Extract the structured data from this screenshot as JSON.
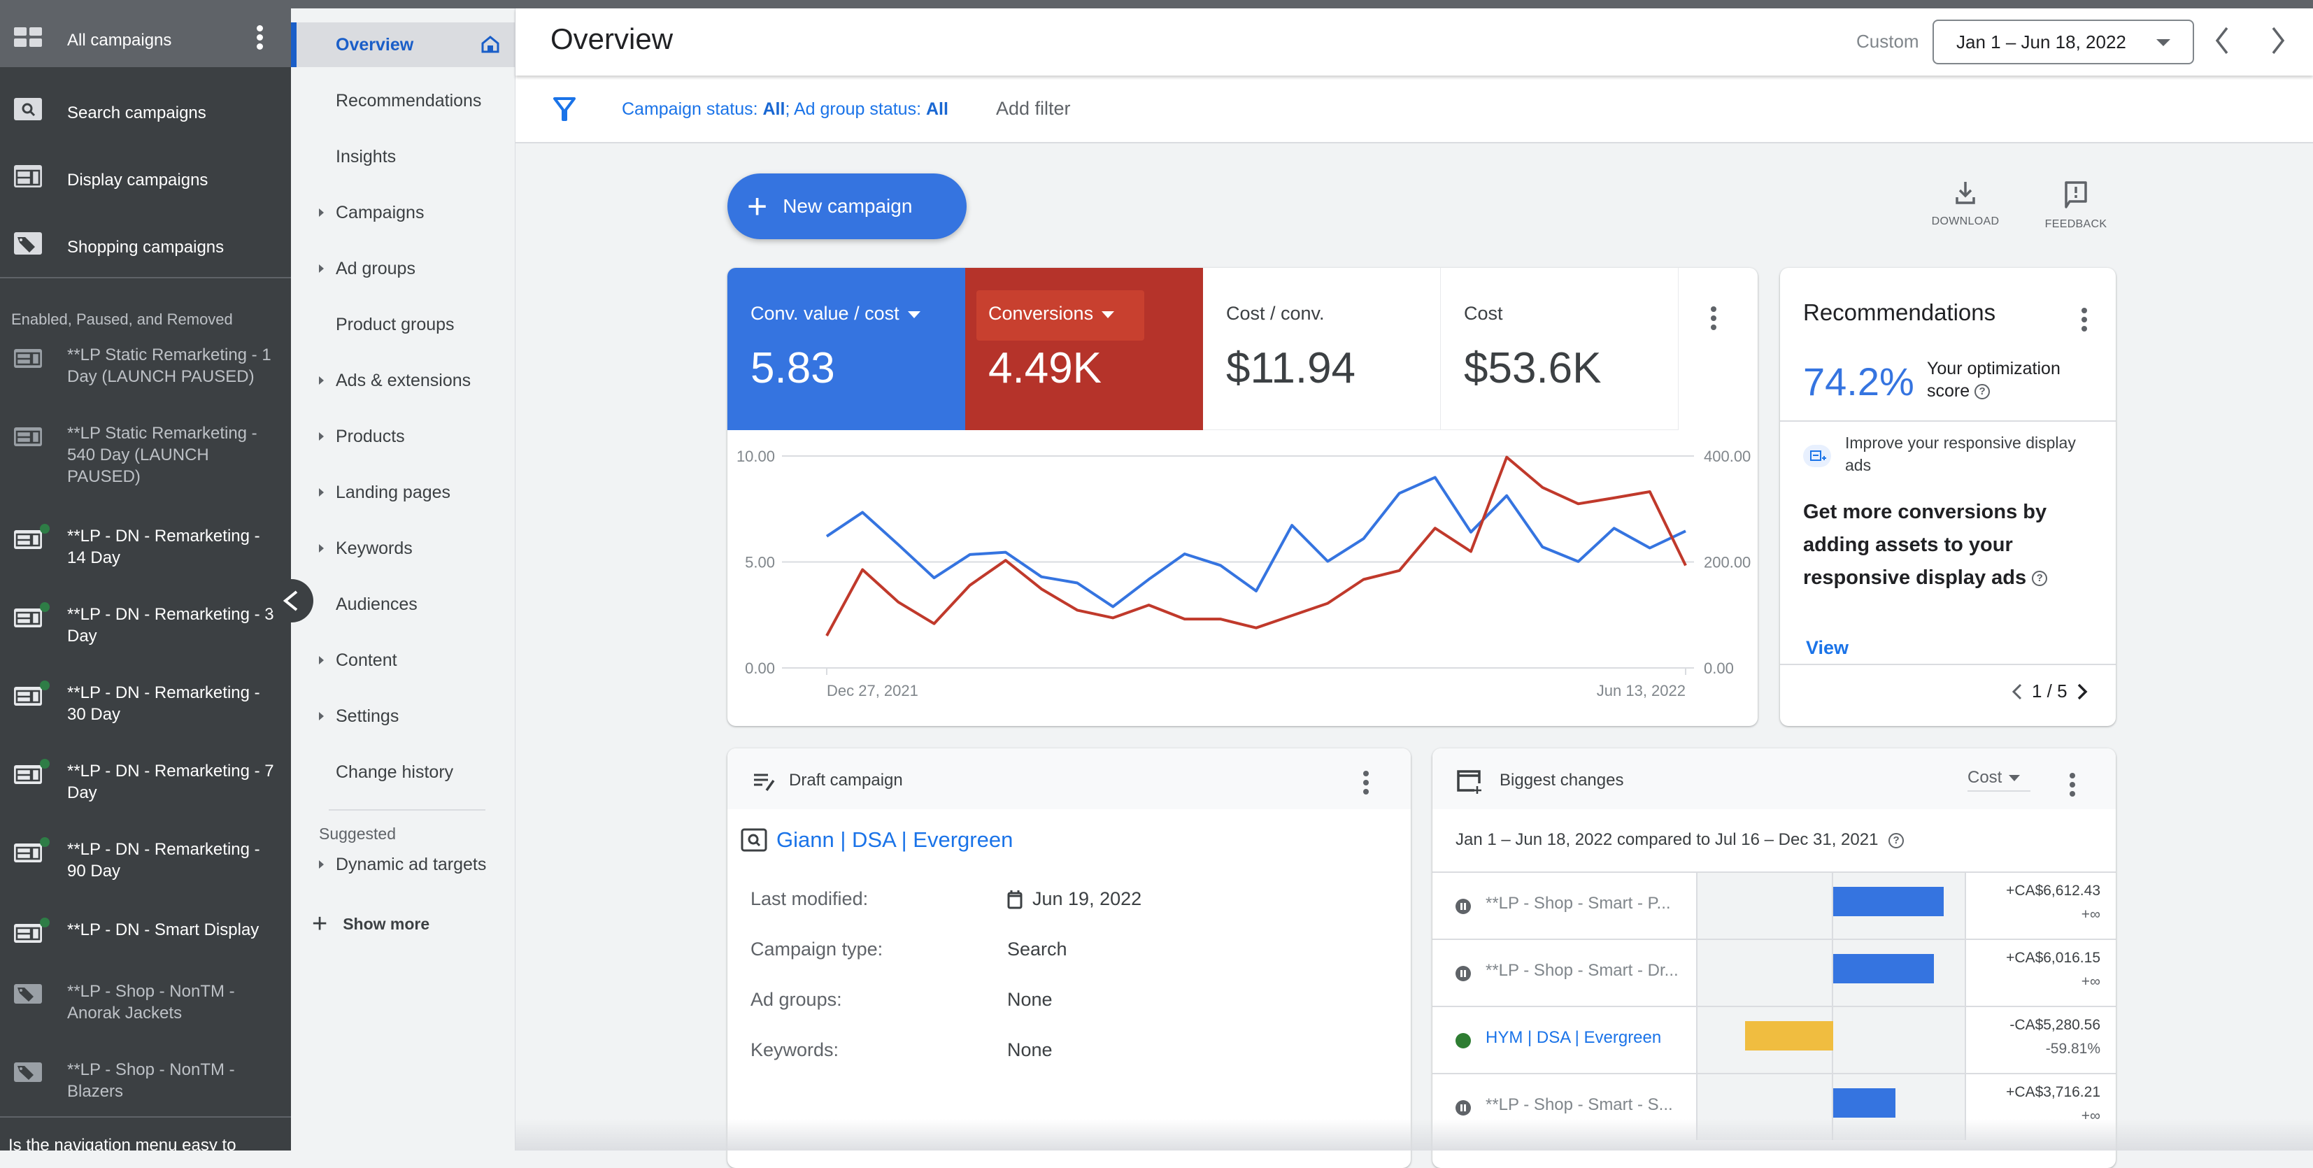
{
  "campaign_sidebar": {
    "all": {
      "label": "All campaigns",
      "icon": "grid-icon"
    },
    "types": [
      {
        "label": "Search campaigns",
        "icon": "search-campaign-icon"
      },
      {
        "label": "Display campaigns",
        "icon": "display-campaign-icon"
      },
      {
        "label": "Shopping campaigns",
        "icon": "shopping-tag-icon"
      }
    ],
    "section_label": "Enabled, Paused, and Removed",
    "campaigns": [
      {
        "label": "**LP Static Remarketing - 1 Day (LAUNCH PAUSED)",
        "type": "display",
        "status": "paused"
      },
      {
        "label": "**LP Static Remarketing - 540 Day (LAUNCH PAUSED)",
        "type": "display",
        "status": "paused"
      },
      {
        "label": "**LP - DN - Remarketing - 14 Day",
        "type": "display",
        "status": "enabled"
      },
      {
        "label": "**LP - DN - Remarketing - 3 Day",
        "type": "display",
        "status": "enabled"
      },
      {
        "label": "**LP - DN - Remarketing - 30 Day",
        "type": "display",
        "status": "enabled"
      },
      {
        "label": "**LP - DN - Remarketing - 7 Day",
        "type": "display",
        "status": "enabled"
      },
      {
        "label": "**LP - DN - Remarketing - 90 Day",
        "type": "display",
        "status": "enabled"
      },
      {
        "label": "**LP - DN - Smart Display",
        "type": "display",
        "status": "enabled"
      },
      {
        "label": "**LP - Shop - NonTM - Anorak Jackets",
        "type": "shopping",
        "status": "paused"
      },
      {
        "label": "**LP - Shop - NonTM - Blazers",
        "type": "shopping",
        "status": "paused"
      }
    ],
    "footer_text": "Is the navigation menu easy to"
  },
  "nav": {
    "items": [
      {
        "label": "Overview",
        "expandable": false,
        "active": true
      },
      {
        "label": "Recommendations",
        "expandable": false
      },
      {
        "label": "Insights",
        "expandable": false
      },
      {
        "label": "Campaigns",
        "expandable": true
      },
      {
        "label": "Ad groups",
        "expandable": true
      },
      {
        "label": "Product groups",
        "expandable": false
      },
      {
        "label": "Ads & extensions",
        "expandable": true
      },
      {
        "label": "Products",
        "expandable": true
      },
      {
        "label": "Landing pages",
        "expandable": true
      },
      {
        "label": "Keywords",
        "expandable": true
      },
      {
        "label": "Audiences",
        "expandable": false
      },
      {
        "label": "Content",
        "expandable": true
      },
      {
        "label": "Settings",
        "expandable": true
      },
      {
        "label": "Change history",
        "expandable": false
      }
    ],
    "suggested_label": "Suggested",
    "suggested_items": [
      {
        "label": "Dynamic ad targets",
        "expandable": true
      }
    ],
    "show_more": "Show more"
  },
  "header": {
    "title": "Overview",
    "date_preset": "Custom",
    "date_range": "Jan 1 – Jun 18, 2022"
  },
  "filter": {
    "prefix1": "Campaign status: ",
    "value1": "All",
    "prefix2": "; Ad group status: ",
    "value2": "All",
    "add_filter": "Add filter"
  },
  "toolbar": {
    "new_campaign": "New campaign",
    "download": "DOWNLOAD",
    "feedback": "FEEDBACK"
  },
  "scorecards": [
    {
      "label": "Conv. value / cost",
      "value": "5.83",
      "selected": true,
      "color": "#3574e0"
    },
    {
      "label": "Conversions",
      "value": "4.49K",
      "selected": true,
      "color": "#b5332a"
    },
    {
      "label": "Cost / conv.",
      "value": "$11.94",
      "selected": false
    },
    {
      "label": "Cost",
      "value": "$53.6K",
      "selected": false
    }
  ],
  "chart_data": {
    "type": "line",
    "x_start_label": "Dec 27, 2021",
    "x_end_label": "Jun 13, 2022",
    "x_ticks": [
      "Dec 27, 2021",
      "Jun 13, 2022"
    ],
    "interval": "weekly",
    "left_axis": {
      "ticks": [
        "0.00",
        "5.00",
        "10.00"
      ],
      "range": [
        0,
        10
      ]
    },
    "right_axis": {
      "ticks": [
        "0.00",
        "200.00",
        "400.00"
      ],
      "range": [
        0,
        400
      ]
    },
    "grid": true,
    "series": [
      {
        "name": "Conv. value / cost",
        "axis": "left",
        "color": "#3574e0",
        "values": [
          6.21,
          7.34,
          5.82,
          4.25,
          5.35,
          5.46,
          4.3,
          4.01,
          2.89,
          4.18,
          5.38,
          4.84,
          3.63,
          6.73,
          5.03,
          6.1,
          8.24,
          8.99,
          6.41,
          8.13,
          5.71,
          5.02,
          6.59,
          5.66,
          6.46
        ]
      },
      {
        "name": "Conversions",
        "axis": "right",
        "color": "#c0392b",
        "values": [
          60.7,
          185.5,
          124.4,
          83.5,
          156.0,
          203.0,
          149.0,
          109.0,
          94.5,
          118.7,
          92.3,
          92.3,
          75.6,
          98.9,
          122.0,
          167.0,
          183.7,
          263.7,
          219.8,
          397.8,
          340.7,
          309.9,
          320.9,
          332.7,
          193.4
        ]
      }
    ]
  },
  "recommendations": {
    "title": "Recommendations",
    "score": "74.2%",
    "score_label": "Your optimization score",
    "subtitle": "Improve your responsive display ads",
    "body": "Get more conversions by adding assets to your responsive display ads",
    "view": "View",
    "pager": "1 / 5"
  },
  "draft": {
    "title": "Draft campaign",
    "campaign_name": "Giann | DSA | Evergreen",
    "fields": [
      {
        "label": "Last modified:",
        "value": "Jun 19, 2022",
        "icon": "calendar-icon"
      },
      {
        "label": "Campaign type:",
        "value": "Search"
      },
      {
        "label": "Ad groups:",
        "value": "None"
      },
      {
        "label": "Keywords:",
        "value": "None"
      }
    ]
  },
  "biggest_changes": {
    "title": "Biggest changes",
    "metric": "Cost",
    "comparison": "Jan 1 – Jun 18, 2022 compared to Jul 16 – Dec 31, 2021",
    "max_abs_change": 6612.43,
    "rows": [
      {
        "name": "**LP - Shop - Smart - P...",
        "status": "paused",
        "change": 6612.43,
        "amount": "+CA$6,612.43",
        "pct": "+∞"
      },
      {
        "name": "**LP - Shop - Smart - Dr...",
        "status": "paused",
        "change": 6016.15,
        "amount": "+CA$6,016.15",
        "pct": "+∞"
      },
      {
        "name": "HYM | DSA | Evergreen",
        "status": "enabled",
        "change": -5280.56,
        "amount": "-CA$5,280.56",
        "pct": "-59.81%"
      },
      {
        "name": "**LP - Shop - Smart - S...",
        "status": "paused",
        "change": 3716.21,
        "amount": "+CA$3,716.21",
        "pct": "+∞"
      }
    ],
    "colors": {
      "increase": "#3574e0",
      "decrease": "#f0bd40"
    }
  }
}
